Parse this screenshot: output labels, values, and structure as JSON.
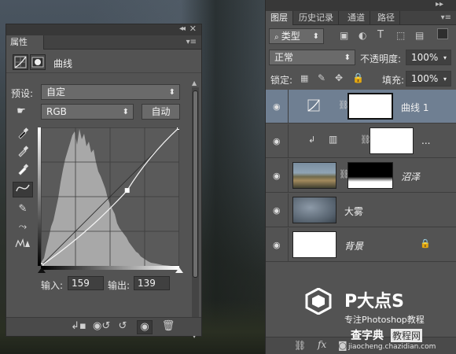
{
  "properties": {
    "tab_label": "属性",
    "adjustment_title": "曲线",
    "preset_label": "预设:",
    "preset_value": "自定",
    "channel_value": "RGB",
    "auto_button": "自动",
    "input_label": "输入:",
    "input_value": "159",
    "output_label": "输出:",
    "output_value": "139"
  },
  "layers": {
    "tabs": [
      "图层",
      "历史记录",
      "通道",
      "路径"
    ],
    "filter_kind": "类型",
    "blend_mode": "正常",
    "opacity_label": "不透明度:",
    "opacity_value": "100%",
    "lock_label": "锁定:",
    "fill_label": "填充:",
    "fill_value": "100%",
    "items": [
      {
        "name": "曲线 1"
      },
      {
        "name": "..."
      },
      {
        "name": "沼泽"
      },
      {
        "name": "大雾"
      },
      {
        "name": "背景"
      }
    ]
  },
  "watermark": {
    "brand": "P大点S",
    "subtitle": "专注Photoshop教程",
    "site_a": "查字典",
    "site_b": "教程网",
    "site_url": "jiaocheng.chazidian.com"
  },
  "colors": {
    "panel_bg": "#535353",
    "selected_layer": "#6f7f92",
    "histogram": "#a8a8a8"
  },
  "curve": {
    "input_range": [
      0,
      255
    ],
    "output_range": [
      0,
      255
    ],
    "control_points": [
      [
        0,
        0
      ],
      [
        159,
        139
      ],
      [
        255,
        255
      ]
    ]
  }
}
